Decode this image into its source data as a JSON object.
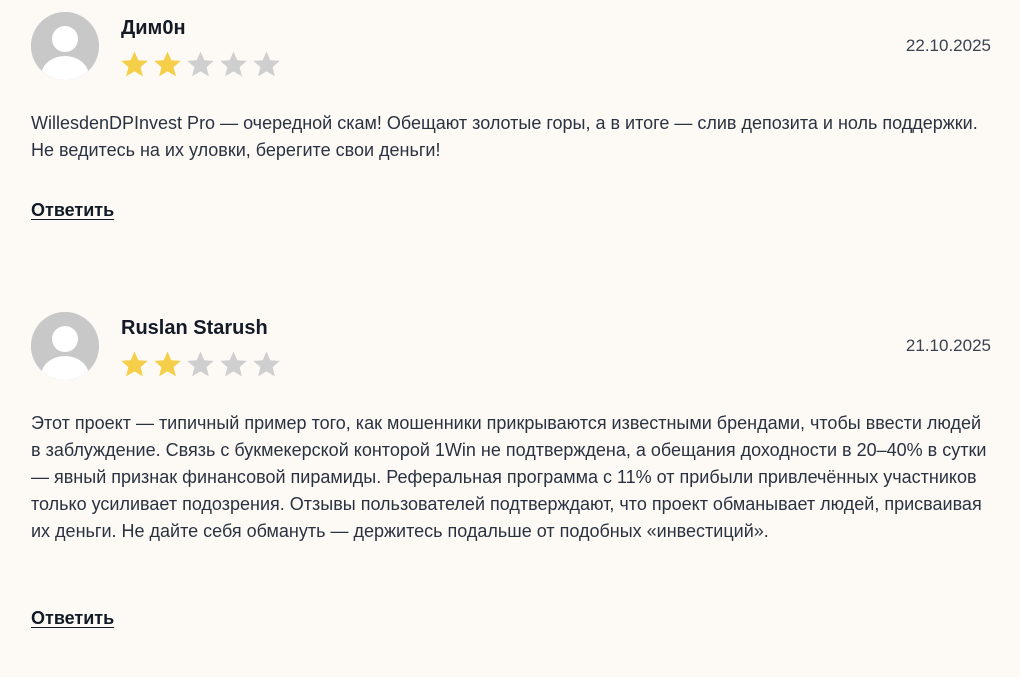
{
  "colors": {
    "background": "#fdfaf6",
    "star_filled": "#f6cf4a",
    "star_empty": "#cfcfcf",
    "avatar_bg": "#c8c8c8"
  },
  "reviews": [
    {
      "author": "Дим0н",
      "rating": 2,
      "max_rating": 5,
      "date": "22.10.2025",
      "text": "WillesdenDPInvest Pro — очередной скам! Обещают золотые горы, а в итоге — слив депозита и ноль поддержки. Не ведитесь на их уловки, берегите свои деньги!",
      "reply_label": "Ответить",
      "avatar_icon": "user-avatar-icon"
    },
    {
      "author": "Ruslan Starush",
      "rating": 2,
      "max_rating": 5,
      "date": "21.10.2025",
      "text": "Этот проект — типичный пример того, как мошенники прикрываются известными брендами, чтобы ввести людей в заблуждение. Связь с букмекерской конторой 1Win не подтверждена, а обещания доходности в 20–40% в сутки — явный признак финансовой пирамиды. Реферальная программа с 11% от прибыли привлечённых участников только усиливает подозрения. Отзывы пользователей подтверждают, что проект обманывает людей, присваивая их деньги. Не дайте себя обмануть — держитесь подальше от подобных «инвестиций».",
      "reply_label": "Ответить",
      "avatar_icon": "user-avatar-icon"
    }
  ]
}
